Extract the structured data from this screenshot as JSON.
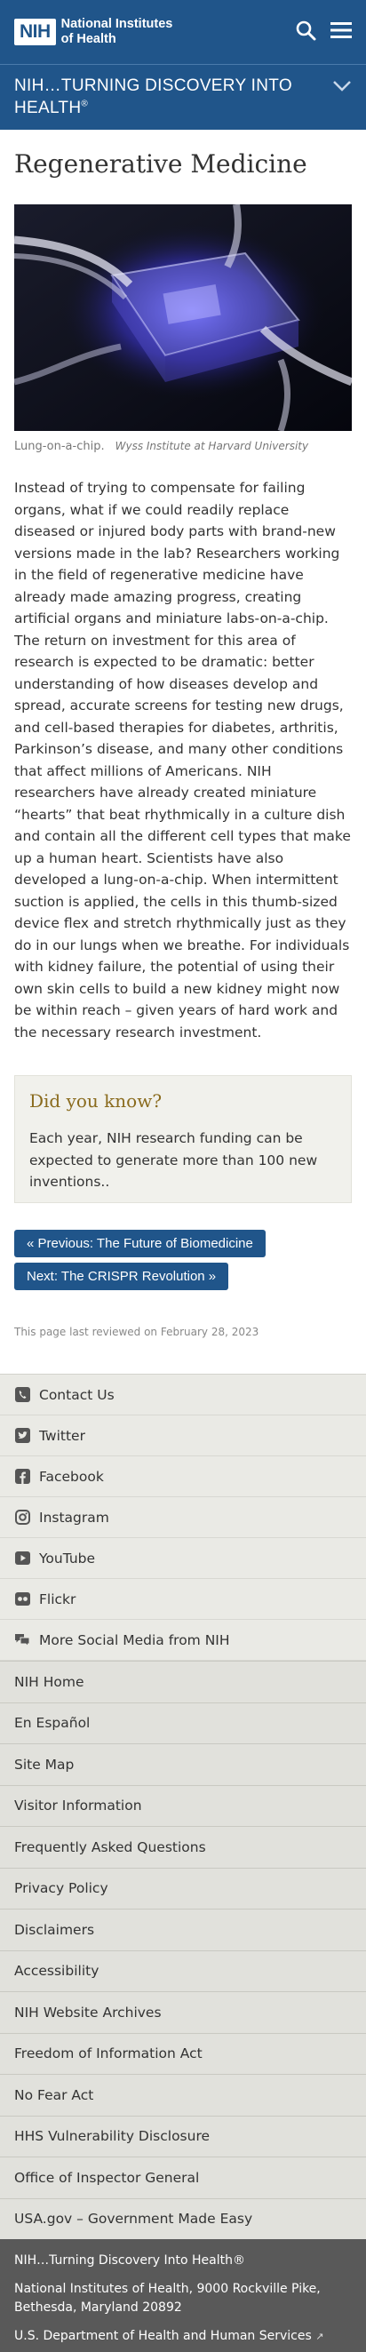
{
  "header": {
    "logo_mark": "NIH",
    "logo_line1": "National Institutes",
    "logo_line2": "of Health"
  },
  "banner": {
    "title": "NIH…TURNING DISCOVERY INTO HEALTH",
    "reg": "®"
  },
  "page": {
    "title": "Regenerative Medicine",
    "caption": "Lung-on-a-chip.",
    "credit": "Wyss Institute at Harvard University",
    "body": "Instead of trying to compensate for failing organs, what if we could readily replace diseased or injured body parts with brand-new versions made in the lab? Researchers working in the field of regenerative medicine have already made amazing progress, creating artificial organs and miniature labs-on-a-chip. The return on investment for this area of research is expected to be dramatic: better understanding of how diseases develop and spread, accurate screens for testing new drugs, and cell-based therapies for diabetes, arthritis, Parkinson’s disease, and many other conditions that affect millions of Americans. NIH researchers have already created miniature “hearts” that beat rhythmically in a culture dish and contain all the different cell types that make up a human heart. Scientists have also developed a lung-on-a-chip. When intermittent suction is applied, the cells in this thumb-sized device flex and stretch rhythmically just as they do in our lungs when we breathe. For individuals with kidney failure, the potential of using their own skin cells to build a new kidney might now be within reach – given years of hard work and the necessary research investment."
  },
  "didyouknow": {
    "heading": "Did you know?",
    "text": "Each year, NIH research funding can be expected to generate more than 100 new inventions.."
  },
  "pager": {
    "prev": "« Previous: The Future of Biomedicine",
    "next": "Next: The CRISPR Revolution »"
  },
  "reviewed": "This page last reviewed on February 28, 2023",
  "social": [
    {
      "label": "Contact Us",
      "icon": "phone-icon"
    },
    {
      "label": "Twitter",
      "icon": "twitter-icon"
    },
    {
      "label": "Facebook",
      "icon": "facebook-icon"
    },
    {
      "label": "Instagram",
      "icon": "instagram-icon"
    },
    {
      "label": "YouTube",
      "icon": "youtube-icon"
    },
    {
      "label": "Flickr",
      "icon": "flickr-icon"
    },
    {
      "label": "More Social Media from NIH",
      "icon": "chat-icon"
    }
  ],
  "links": [
    "NIH Home",
    "En Español",
    "Site Map",
    "Visitor Information",
    "Frequently Asked Questions",
    "Privacy Policy",
    "Disclaimers",
    "Accessibility",
    "NIH Website Archives",
    "Freedom of Information Act",
    "No Fear Act",
    "HHS Vulnerability Disclosure",
    "Office of Inspector General",
    "USA.gov – Government Made Easy"
  ],
  "footer": {
    "tagline": "NIH…Turning Discovery Into Health®",
    "address": "National Institutes of Health, 9000 Rockville Pike, Bethesda, Maryland 20892",
    "hhs": "U.S. Department of Health and Human Services"
  },
  "colors": {
    "brand": "#20558a",
    "did_you_know_heading": "#8a6b1e",
    "footer": "#595959"
  }
}
